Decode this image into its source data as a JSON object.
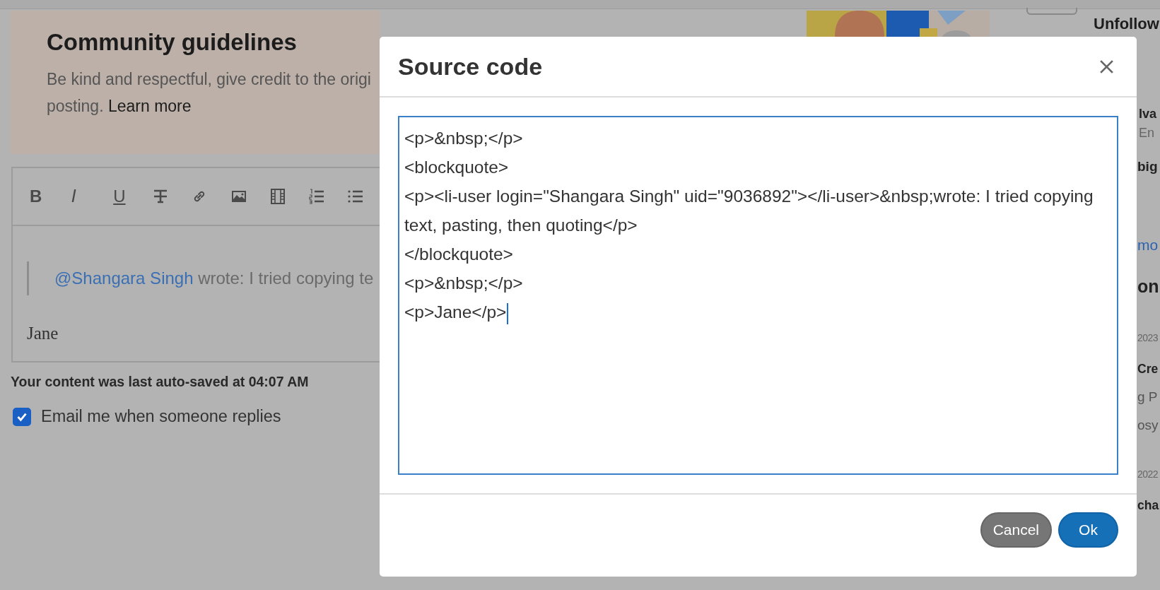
{
  "guidelines": {
    "title": "Community guidelines",
    "line1": "Be kind and respectful, give credit to the origi",
    "line2": "posting.",
    "link": "Learn more"
  },
  "editor": {
    "toolbar": [
      {
        "kind": "bold",
        "label": "B"
      },
      {
        "kind": "italic",
        "label": "I"
      },
      {
        "kind": "underline",
        "label": "U"
      }
    ],
    "mention": "@Shangara Singh",
    "quote": " wrote: I tried copying te",
    "signature": "Jane"
  },
  "autosave": "Your content was last auto-saved at 04:07 AM",
  "email_option": {
    "label": "Email me when someone replies",
    "checked": true
  },
  "follow": {
    "label": "Unfollow"
  },
  "sidebar": [
    {
      "kind": "name",
      "text": "Iva"
    },
    {
      "kind": "meta",
      "text": "En"
    },
    {
      "kind": "heading",
      "text": "big"
    },
    {
      "kind": "link",
      "text": "mo"
    },
    {
      "kind": "section",
      "text": "on"
    },
    {
      "kind": "date",
      "text": "2023"
    },
    {
      "kind": "title",
      "text": "Cre"
    },
    {
      "kind": "text",
      "text": "g P"
    },
    {
      "kind": "text",
      "text": "osy"
    },
    {
      "kind": "date",
      "text": "2022"
    },
    {
      "kind": "title",
      "text": "cha"
    }
  ],
  "dialog": {
    "title": "Source code",
    "code_lines": [
      "<p>&nbsp;</p>",
      "<blockquote>",
      "<p><li-user login=\"Shangara Singh\" uid=\"9036892\"></li-user>&nbsp;wrote: I tried copying text, pasting, then quoting</p>",
      "</blockquote>",
      "<p>&nbsp;</p>",
      "<p>Jane</p>"
    ],
    "buttons": [
      {
        "kind": "secondary",
        "label": "Cancel"
      },
      {
        "kind": "primary",
        "label": "Ok"
      }
    ]
  }
}
